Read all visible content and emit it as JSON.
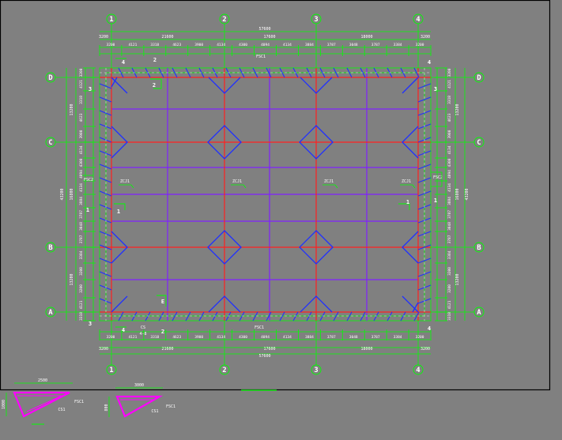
{
  "colors": {
    "background": "#808080",
    "frame": "#000000",
    "grid_red": "#ff2020",
    "beam_blue": "#2030ff",
    "purlin_purple": "#8020ff",
    "dim_green": "#00ff00",
    "label_white": "#ffffff",
    "magenta": "#ff00ff"
  },
  "axes": {
    "numbers": [
      "1",
      "2",
      "3",
      "4"
    ],
    "letters": [
      "D",
      "C",
      "B",
      "A"
    ]
  },
  "dims": {
    "overall_width": "57600",
    "overall_height": "43200",
    "span_12": "21600",
    "span_23": "17600",
    "span_34": "18000",
    "edge_left": "3200",
    "edge_right": "3200",
    "left_height_1": "13200",
    "left_height_2": "16800",
    "left_height_3": "13200",
    "right_height_1": "13200",
    "right_height_2": "16800",
    "right_height_3": "13200",
    "small": [
      "3200",
      "4121",
      "3318",
      "4623",
      "3900",
      "4134",
      "4300",
      "4094",
      "4134",
      "3884",
      "3787",
      "3048",
      "3787",
      "3384",
      "3200"
    ]
  },
  "labels": {
    "column_markers": [
      "ZCJ1",
      "ZCJ1",
      "ZCJ1",
      "ZCJ1"
    ],
    "top_tag": "FSC1",
    "bottom_tag": "FSC1",
    "left_tag": "FSC2",
    "right_tag": "FSC2",
    "section_mark": "1",
    "corner_num_2": "2",
    "corner_num_3": "3",
    "corner_num_4": "4",
    "cs_label": "CS",
    "cs_sub": "4-8",
    "e_label": "E"
  },
  "details": [
    {
      "dim_top": "2500",
      "dim_side": "1000",
      "tag_a": "CS1",
      "tag_b": "FSC1"
    },
    {
      "dim_top": "3000",
      "dim_side": "800",
      "tag_a": "CS1",
      "tag_b": "FSC1"
    }
  ]
}
